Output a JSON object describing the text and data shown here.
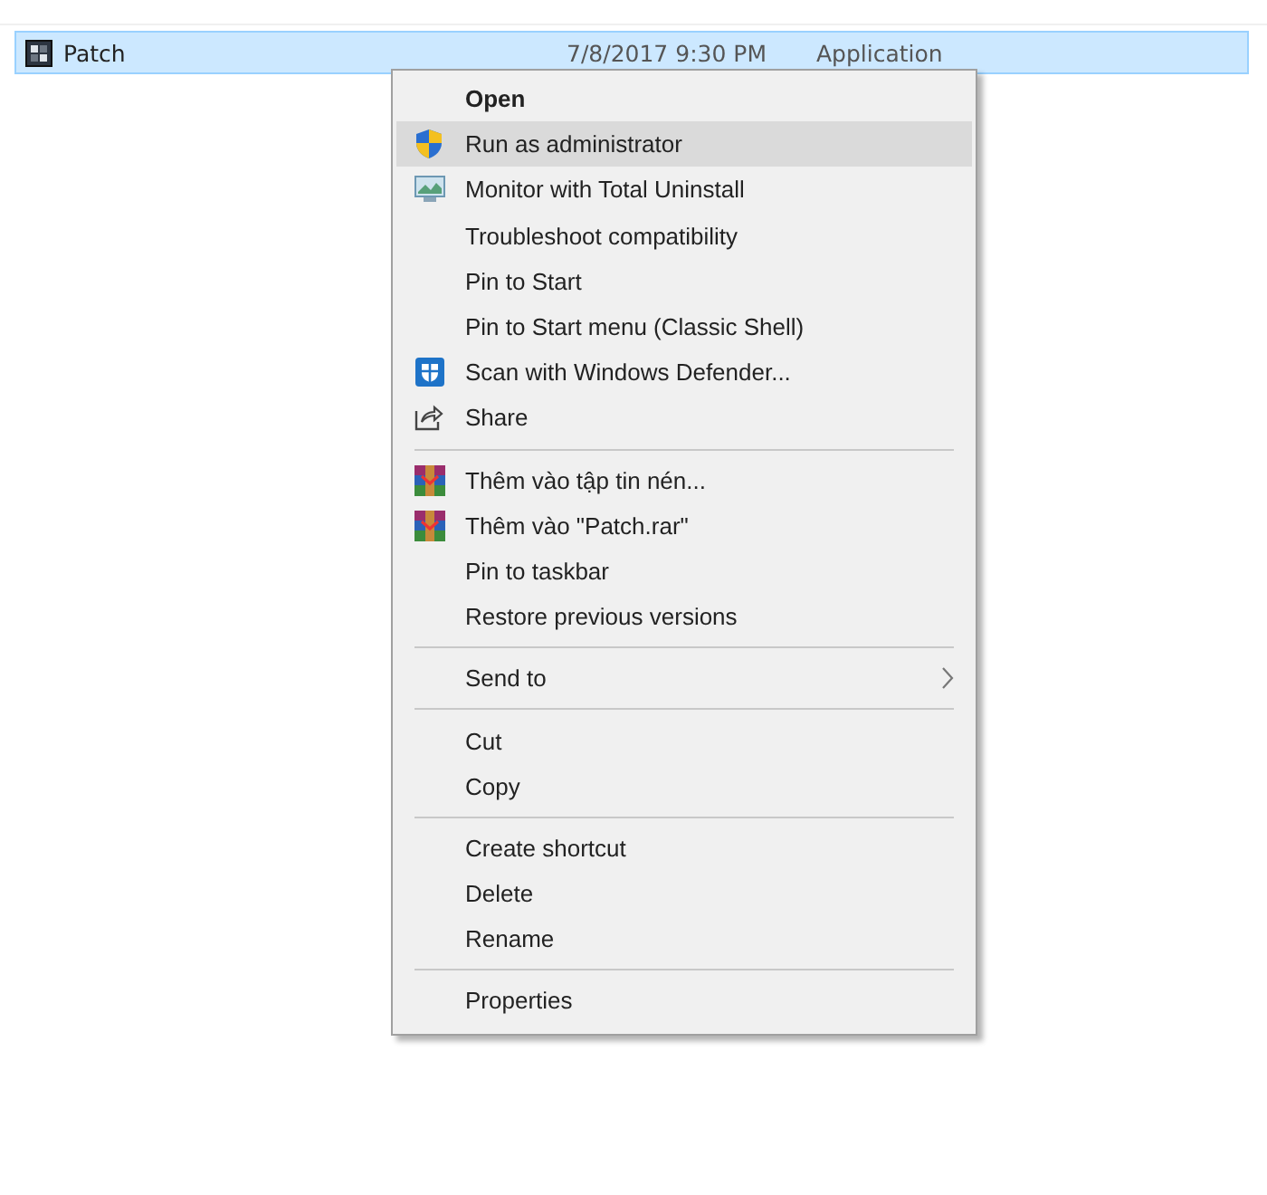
{
  "file_row": {
    "name": "Patch",
    "date_modified": "7/8/2017 9:30 PM",
    "type": "Application",
    "selected": true
  },
  "context_menu": {
    "groups": [
      [
        {
          "label": "Open",
          "kind": "plain",
          "default": true,
          "selected": false
        },
        {
          "label": "Run as administrator",
          "kind": "shield",
          "default": false,
          "selected": true
        },
        {
          "label": "Monitor with Total Uninstall",
          "kind": "monitor",
          "default": false,
          "selected": false
        },
        {
          "label": "Troubleshoot compatibility",
          "kind": "plain",
          "default": false,
          "selected": false
        },
        {
          "label": "Pin to Start",
          "kind": "plain",
          "default": false,
          "selected": false
        },
        {
          "label": "Pin to Start menu (Classic Shell)",
          "kind": "plain",
          "default": false,
          "selected": false
        },
        {
          "label": "Scan with Windows Defender...",
          "kind": "defender",
          "default": false,
          "selected": false
        },
        {
          "label": "Share",
          "kind": "share",
          "default": false,
          "selected": false
        }
      ],
      [
        {
          "label": "Thêm vào tập tin nén...",
          "kind": "archive",
          "default": false,
          "selected": false
        },
        {
          "label": "Thêm vào \"Patch.rar\"",
          "kind": "archive",
          "default": false,
          "selected": false
        },
        {
          "label": "Pin to taskbar",
          "kind": "plain",
          "default": false,
          "selected": false
        },
        {
          "label": "Restore previous versions",
          "kind": "plain",
          "default": false,
          "selected": false
        }
      ],
      [
        {
          "label": "Send to",
          "kind": "submenu",
          "default": false,
          "selected": false
        }
      ],
      [
        {
          "label": "Cut",
          "kind": "plain",
          "default": false,
          "selected": false
        },
        {
          "label": "Copy",
          "kind": "plain",
          "default": false,
          "selected": false
        }
      ],
      [
        {
          "label": "Create shortcut",
          "kind": "plain",
          "default": false,
          "selected": false
        },
        {
          "label": "Delete",
          "kind": "plain",
          "default": false,
          "selected": false
        },
        {
          "label": "Rename",
          "kind": "plain",
          "default": false,
          "selected": false
        }
      ],
      [
        {
          "label": "Properties",
          "kind": "plain",
          "default": false,
          "selected": false
        }
      ]
    ]
  }
}
